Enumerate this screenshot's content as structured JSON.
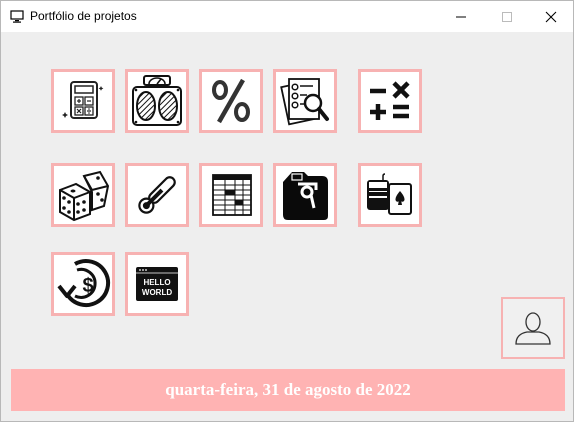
{
  "window": {
    "title": "Portfólio de projetos",
    "app_icon": "monitor-icon",
    "controls": [
      "minimize-icon",
      "maximize-icon",
      "close-icon"
    ]
  },
  "projects": [
    {
      "icon": "calculator-icon"
    },
    {
      "icon": "scale-icon"
    },
    {
      "icon": "percent-icon"
    },
    {
      "icon": "checklist-search-icon"
    },
    {
      "icon": "math-operators-icon"
    },
    {
      "icon": "dice-icon"
    },
    {
      "icon": "thermometer-icon"
    },
    {
      "icon": "spreadsheet-icon"
    },
    {
      "icon": "jerrycan-icon"
    },
    {
      "icon": "card-deck-icon"
    },
    {
      "icon": "money-cycle-icon"
    },
    {
      "icon": "hello-world-icon",
      "label": "HELLO WORLD"
    }
  ],
  "user_button": {
    "icon": "user-icon"
  },
  "footer": {
    "date": "quarta-feira, 31 de agosto de 2022"
  },
  "colors": {
    "tile_border": "#f7b2b2",
    "date_bar": "#ffb3b3",
    "background": "#eeeeee"
  }
}
